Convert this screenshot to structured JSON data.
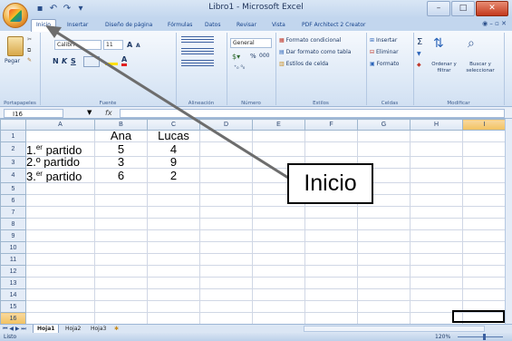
{
  "window": {
    "title": "Libro1 - Microsoft Excel",
    "minimize": "–",
    "maximize": "□",
    "close": "✕"
  },
  "qat": {
    "save_icon": "save-icon",
    "undo_icon": "undo-icon",
    "redo_icon": "redo-icon"
  },
  "tabs": [
    "Inicio",
    "Insertar",
    "Diseño de página",
    "Fórmulas",
    "Datos",
    "Revisar",
    "Vista",
    "PDF Architect 2 Creator"
  ],
  "ribbon": {
    "clipboard": {
      "paste": "Pegar",
      "name": "Portapapeles"
    },
    "font": {
      "font_name": "Calibri",
      "font_size": "11",
      "bold": "N",
      "italic": "K",
      "underline": "S",
      "grow": "A",
      "shrink": "A",
      "name": "Fuente"
    },
    "alignment": {
      "name": "Alineación"
    },
    "number": {
      "format": "General",
      "percent": "%",
      "thousands": "000",
      "name": "Número"
    },
    "styles": {
      "conditional": "Formato condicional",
      "table": "Dar formato como tabla",
      "cell": "Estilos de celda",
      "name": "Estilos"
    },
    "cells": {
      "insert": "Insertar",
      "delete": "Eliminar",
      "format": "Formato",
      "name": "Celdas"
    },
    "editing": {
      "sum": "Σ",
      "sort": "Ordenar y filtrar",
      "find": "Buscar y seleccionar",
      "name": "Modificar"
    }
  },
  "formula_bar": {
    "name_box": "I16",
    "fx": "fx",
    "value": ""
  },
  "columns": [
    "A",
    "B",
    "C",
    "D",
    "E",
    "F",
    "G",
    "H",
    "I"
  ],
  "rows": [
    {
      "n": "1",
      "a": "",
      "a_sup": "",
      "a_rest": "",
      "b": "Ana",
      "c": "Lucas"
    },
    {
      "n": "2",
      "a": "1.",
      "a_sup": "er",
      "a_rest": " partido",
      "b": "5",
      "c": "4"
    },
    {
      "n": "3",
      "a": "2.º partido",
      "a_sup": "",
      "a_rest": "",
      "b": "3",
      "c": "9"
    },
    {
      "n": "4",
      "a": "3.",
      "a_sup": "er",
      "a_rest": " partido",
      "b": "6",
      "c": "2"
    },
    {
      "n": "5"
    },
    {
      "n": "6"
    },
    {
      "n": "7"
    },
    {
      "n": "8"
    },
    {
      "n": "9"
    },
    {
      "n": "10"
    },
    {
      "n": "11"
    },
    {
      "n": "12"
    },
    {
      "n": "13"
    },
    {
      "n": "14"
    },
    {
      "n": "15"
    },
    {
      "n": "16"
    }
  ],
  "sheet_tabs": [
    "Hoja1",
    "Hoja2",
    "Hoja3"
  ],
  "status": {
    "ready": "Listo",
    "zoom": "120%"
  },
  "callout": {
    "text": "Inicio"
  },
  "colors": {
    "ribbon": "#dce8f6",
    "header": "#e4ecf7",
    "selected_header": "#f1c15f"
  }
}
